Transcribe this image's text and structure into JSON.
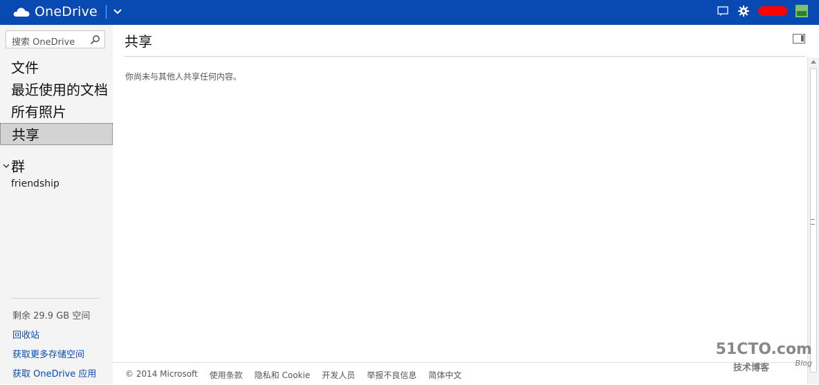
{
  "app": {
    "brand": "OneDrive",
    "accent": "#094AB2"
  },
  "top_right": {
    "icons": [
      "comment-icon",
      "gear-icon",
      "user-name-redacted",
      "avatar"
    ]
  },
  "search": {
    "placeholder": "搜索 OneDrive"
  },
  "nav": {
    "items": [
      {
        "label": "文件",
        "selected": false
      },
      {
        "label": "最近使用的文档",
        "selected": false
      },
      {
        "label": "所有照片",
        "selected": false
      },
      {
        "label": "共享",
        "selected": true
      }
    ]
  },
  "groups": {
    "header": "群",
    "items": [
      "friendship"
    ]
  },
  "storage": {
    "remaining": "剩余 29.9 GB 空间"
  },
  "links": {
    "recycle": "回收站",
    "get_more_storage": "获取更多存储空间",
    "get_apps": "获取 OneDrive 应用"
  },
  "main": {
    "title": "共享",
    "empty_message": "你尚未与其他人共享任何内容。"
  },
  "footer": {
    "links": [
      "© 2014 Microsoft",
      "使用条款",
      "隐私和 Cookie",
      "开发人员",
      "举报不良信息",
      "简体中文"
    ]
  },
  "watermark": {
    "site": "51CTO.com",
    "subtitle": "技术博客",
    "blog": "Blog"
  }
}
